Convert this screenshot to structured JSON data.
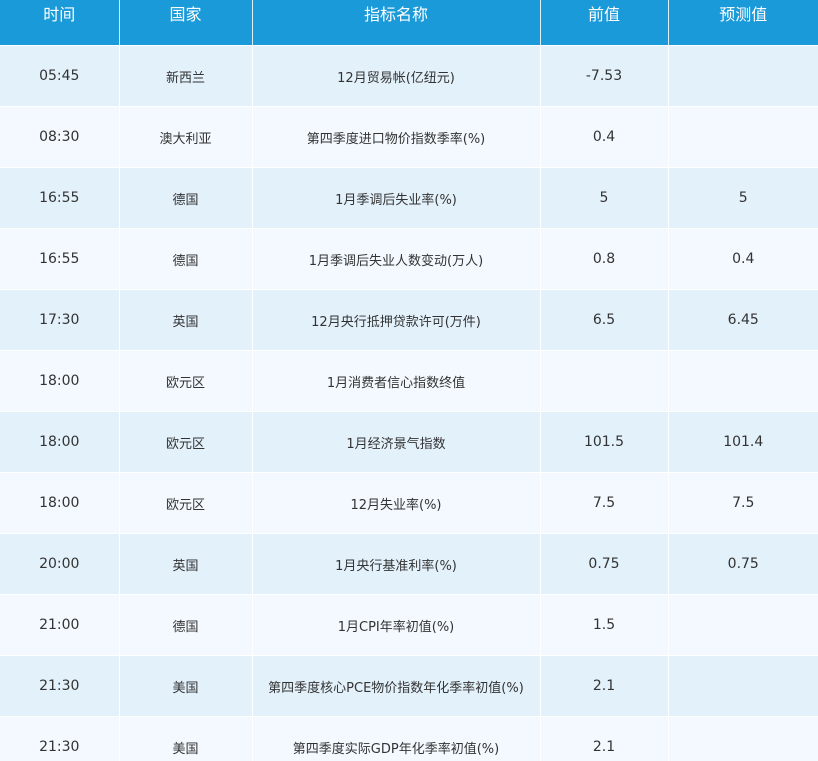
{
  "table": {
    "headers": [
      "时间",
      "国家",
      "指标名称",
      "前值",
      "预测值"
    ],
    "rows": [
      {
        "time": "05:45",
        "country": "新西兰",
        "indicator": "12月贸易帐(亿纽元)",
        "previous": "-7.53",
        "forecast": ""
      },
      {
        "time": "08:30",
        "country": "澳大利亚",
        "indicator": "第四季度进口物价指数季率(%)",
        "previous": "0.4",
        "forecast": ""
      },
      {
        "time": "16:55",
        "country": "德国",
        "indicator": "1月季调后失业率(%)",
        "previous": "5",
        "forecast": "5"
      },
      {
        "time": "16:55",
        "country": "德国",
        "indicator": "1月季调后失业人数变动(万人)",
        "previous": "0.8",
        "forecast": "0.4"
      },
      {
        "time": "17:30",
        "country": "英国",
        "indicator": "12月央行抵押贷款许可(万件)",
        "previous": "6.5",
        "forecast": "6.45"
      },
      {
        "time": "18:00",
        "country": "欧元区",
        "indicator": "1月消费者信心指数终值",
        "previous": "",
        "forecast": ""
      },
      {
        "time": "18:00",
        "country": "欧元区",
        "indicator": "1月经济景气指数",
        "previous": "101.5",
        "forecast": "101.4"
      },
      {
        "time": "18:00",
        "country": "欧元区",
        "indicator": "12月失业率(%)",
        "previous": "7.5",
        "forecast": "7.5"
      },
      {
        "time": "20:00",
        "country": "英国",
        "indicator": "1月央行基准利率(%)",
        "previous": "0.75",
        "forecast": "0.75"
      },
      {
        "time": "21:00",
        "country": "德国",
        "indicator": "1月CPI年率初值(%)",
        "previous": "1.5",
        "forecast": ""
      },
      {
        "time": "21:30",
        "country": "美国",
        "indicator": "第四季度核心PCE物价指数年化季率初值(%)",
        "previous": "2.1",
        "forecast": ""
      },
      {
        "time": "21:30",
        "country": "美国",
        "indicator": "第四季度实际GDP年化季率初值(%)",
        "previous": "2.1",
        "forecast": ""
      }
    ]
  },
  "colors": {
    "header_bg": "#1a9ad8",
    "row_odd": "#e3f1fb",
    "row_even": "#f3f9fe",
    "text": "#333333"
  }
}
